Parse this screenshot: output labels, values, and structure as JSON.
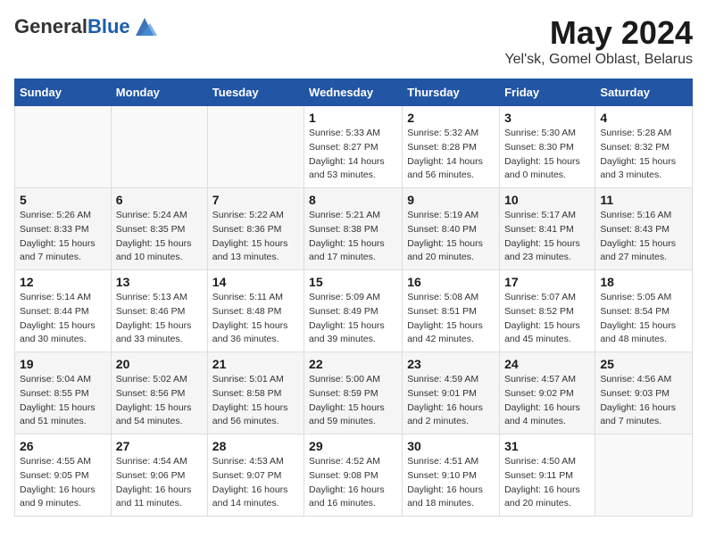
{
  "logo": {
    "general": "General",
    "blue": "Blue"
  },
  "title": "May 2024",
  "subtitle": "Yel'sk, Gomel Oblast, Belarus",
  "days": [
    "Sunday",
    "Monday",
    "Tuesday",
    "Wednesday",
    "Thursday",
    "Friday",
    "Saturday"
  ],
  "weeks": [
    [
      {
        "date": "",
        "sunrise": "",
        "sunset": "",
        "daylight": ""
      },
      {
        "date": "",
        "sunrise": "",
        "sunset": "",
        "daylight": ""
      },
      {
        "date": "",
        "sunrise": "",
        "sunset": "",
        "daylight": ""
      },
      {
        "date": "1",
        "sunrise": "Sunrise: 5:33 AM",
        "sunset": "Sunset: 8:27 PM",
        "daylight": "Daylight: 14 hours and 53 minutes."
      },
      {
        "date": "2",
        "sunrise": "Sunrise: 5:32 AM",
        "sunset": "Sunset: 8:28 PM",
        "daylight": "Daylight: 14 hours and 56 minutes."
      },
      {
        "date": "3",
        "sunrise": "Sunrise: 5:30 AM",
        "sunset": "Sunset: 8:30 PM",
        "daylight": "Daylight: 15 hours and 0 minutes."
      },
      {
        "date": "4",
        "sunrise": "Sunrise: 5:28 AM",
        "sunset": "Sunset: 8:32 PM",
        "daylight": "Daylight: 15 hours and 3 minutes."
      }
    ],
    [
      {
        "date": "5",
        "sunrise": "Sunrise: 5:26 AM",
        "sunset": "Sunset: 8:33 PM",
        "daylight": "Daylight: 15 hours and 7 minutes."
      },
      {
        "date": "6",
        "sunrise": "Sunrise: 5:24 AM",
        "sunset": "Sunset: 8:35 PM",
        "daylight": "Daylight: 15 hours and 10 minutes."
      },
      {
        "date": "7",
        "sunrise": "Sunrise: 5:22 AM",
        "sunset": "Sunset: 8:36 PM",
        "daylight": "Daylight: 15 hours and 13 minutes."
      },
      {
        "date": "8",
        "sunrise": "Sunrise: 5:21 AM",
        "sunset": "Sunset: 8:38 PM",
        "daylight": "Daylight: 15 hours and 17 minutes."
      },
      {
        "date": "9",
        "sunrise": "Sunrise: 5:19 AM",
        "sunset": "Sunset: 8:40 PM",
        "daylight": "Daylight: 15 hours and 20 minutes."
      },
      {
        "date": "10",
        "sunrise": "Sunrise: 5:17 AM",
        "sunset": "Sunset: 8:41 PM",
        "daylight": "Daylight: 15 hours and 23 minutes."
      },
      {
        "date": "11",
        "sunrise": "Sunrise: 5:16 AM",
        "sunset": "Sunset: 8:43 PM",
        "daylight": "Daylight: 15 hours and 27 minutes."
      }
    ],
    [
      {
        "date": "12",
        "sunrise": "Sunrise: 5:14 AM",
        "sunset": "Sunset: 8:44 PM",
        "daylight": "Daylight: 15 hours and 30 minutes."
      },
      {
        "date": "13",
        "sunrise": "Sunrise: 5:13 AM",
        "sunset": "Sunset: 8:46 PM",
        "daylight": "Daylight: 15 hours and 33 minutes."
      },
      {
        "date": "14",
        "sunrise": "Sunrise: 5:11 AM",
        "sunset": "Sunset: 8:48 PM",
        "daylight": "Daylight: 15 hours and 36 minutes."
      },
      {
        "date": "15",
        "sunrise": "Sunrise: 5:09 AM",
        "sunset": "Sunset: 8:49 PM",
        "daylight": "Daylight: 15 hours and 39 minutes."
      },
      {
        "date": "16",
        "sunrise": "Sunrise: 5:08 AM",
        "sunset": "Sunset: 8:51 PM",
        "daylight": "Daylight: 15 hours and 42 minutes."
      },
      {
        "date": "17",
        "sunrise": "Sunrise: 5:07 AM",
        "sunset": "Sunset: 8:52 PM",
        "daylight": "Daylight: 15 hours and 45 minutes."
      },
      {
        "date": "18",
        "sunrise": "Sunrise: 5:05 AM",
        "sunset": "Sunset: 8:54 PM",
        "daylight": "Daylight: 15 hours and 48 minutes."
      }
    ],
    [
      {
        "date": "19",
        "sunrise": "Sunrise: 5:04 AM",
        "sunset": "Sunset: 8:55 PM",
        "daylight": "Daylight: 15 hours and 51 minutes."
      },
      {
        "date": "20",
        "sunrise": "Sunrise: 5:02 AM",
        "sunset": "Sunset: 8:56 PM",
        "daylight": "Daylight: 15 hours and 54 minutes."
      },
      {
        "date": "21",
        "sunrise": "Sunrise: 5:01 AM",
        "sunset": "Sunset: 8:58 PM",
        "daylight": "Daylight: 15 hours and 56 minutes."
      },
      {
        "date": "22",
        "sunrise": "Sunrise: 5:00 AM",
        "sunset": "Sunset: 8:59 PM",
        "daylight": "Daylight: 15 hours and 59 minutes."
      },
      {
        "date": "23",
        "sunrise": "Sunrise: 4:59 AM",
        "sunset": "Sunset: 9:01 PM",
        "daylight": "Daylight: 16 hours and 2 minutes."
      },
      {
        "date": "24",
        "sunrise": "Sunrise: 4:57 AM",
        "sunset": "Sunset: 9:02 PM",
        "daylight": "Daylight: 16 hours and 4 minutes."
      },
      {
        "date": "25",
        "sunrise": "Sunrise: 4:56 AM",
        "sunset": "Sunset: 9:03 PM",
        "daylight": "Daylight: 16 hours and 7 minutes."
      }
    ],
    [
      {
        "date": "26",
        "sunrise": "Sunrise: 4:55 AM",
        "sunset": "Sunset: 9:05 PM",
        "daylight": "Daylight: 16 hours and 9 minutes."
      },
      {
        "date": "27",
        "sunrise": "Sunrise: 4:54 AM",
        "sunset": "Sunset: 9:06 PM",
        "daylight": "Daylight: 16 hours and 11 minutes."
      },
      {
        "date": "28",
        "sunrise": "Sunrise: 4:53 AM",
        "sunset": "Sunset: 9:07 PM",
        "daylight": "Daylight: 16 hours and 14 minutes."
      },
      {
        "date": "29",
        "sunrise": "Sunrise: 4:52 AM",
        "sunset": "Sunset: 9:08 PM",
        "daylight": "Daylight: 16 hours and 16 minutes."
      },
      {
        "date": "30",
        "sunrise": "Sunrise: 4:51 AM",
        "sunset": "Sunset: 9:10 PM",
        "daylight": "Daylight: 16 hours and 18 minutes."
      },
      {
        "date": "31",
        "sunrise": "Sunrise: 4:50 AM",
        "sunset": "Sunset: 9:11 PM",
        "daylight": "Daylight: 16 hours and 20 minutes."
      },
      {
        "date": "",
        "sunrise": "",
        "sunset": "",
        "daylight": ""
      }
    ]
  ]
}
